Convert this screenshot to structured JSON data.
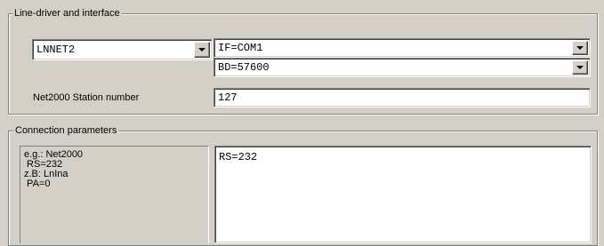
{
  "line_driver": {
    "legend": "Line-driver and interface",
    "driver_select": "LNNET2",
    "interface_select": "IF=COM1",
    "baud_select": "BD=57600",
    "station_label": "Net2000 Station number",
    "station_value": "127"
  },
  "connection": {
    "legend": "Connection parameters",
    "examples": [
      "e.g.: Net2000",
      " RS=232",
      "z.B: LnIna",
      " PA=0"
    ],
    "params_value": "RS=232"
  }
}
